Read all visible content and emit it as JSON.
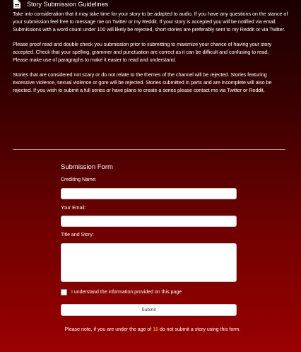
{
  "header": {
    "icon": "file-lines-icon",
    "title": "Story Submission Guidelines"
  },
  "guidelines": {
    "p1a": "Take into consideration that it may take time for your story to be adapted to audio. If you have any questions on the stance of your submission feel free to message me on Twitter or my Reddit. If your story is accepted you will be notified via email.",
    "p1b": "Submissions with a word count under 100 will likely be rejected, short stories are preferably sent to my Reddit or via Twitter.",
    "p2a": "Please proof read and double check you submission prior to submitting to maximize your chance of having your story accepted. Check that your spelling, grammer and punctuation are correct as it can be difficult and confusing to read.",
    "p2b": "Please make use of paragraphs to make it easier to read and understand.",
    "p3": "Stories that are considered not scary or do not relate to the themes of the channel will be rejected. Stories featuring excessive violence, sexual violence or gore will be rejected. Stories submitted in parts and are incomplete will also be rejected. If you wish to submit a full series or have plans to create a series please contact me via Twitter or Reddit."
  },
  "form": {
    "title": "Submission Form",
    "crediting_label": "Crediting Name:",
    "crediting_value": "",
    "email_label": "Your Email:",
    "email_value": "",
    "story_label": "Title and Story:",
    "story_value": "",
    "checkbox_label": "I understand the information provided on this page",
    "checkbox_checked": false,
    "submit_label": "Submit"
  },
  "note": {
    "before": "Please note, if you are under the age of ",
    "age": "18",
    "after": " do not submit a story using this form."
  },
  "colors": {
    "age_highlight": "#ffcc00",
    "background_top": "#1a0000",
    "background_bottom": "#9a0000"
  }
}
